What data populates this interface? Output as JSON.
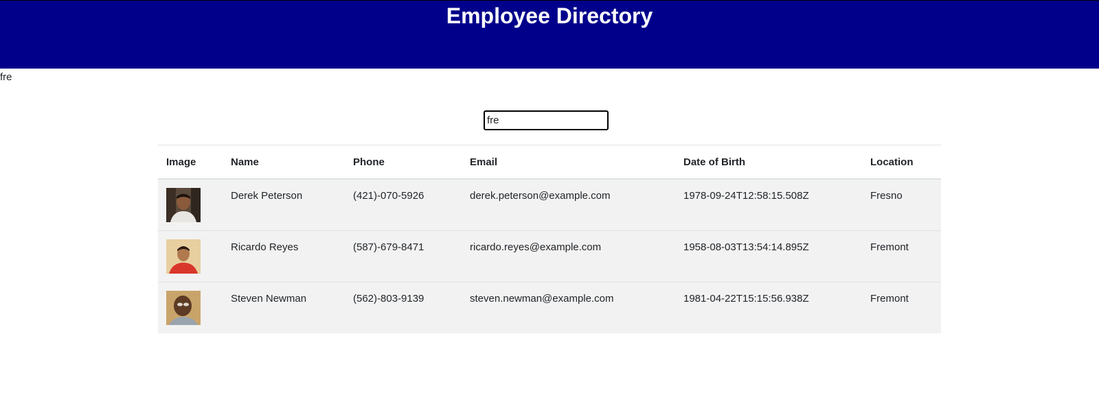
{
  "header": {
    "title": "Employee Directory"
  },
  "search": {
    "echo": "fre",
    "value": "fre"
  },
  "table": {
    "columns": [
      "Image",
      "Name",
      "Phone",
      "Email",
      "Date of Birth",
      "Location"
    ],
    "rows": [
      {
        "image": "portrait-photo",
        "name": "Derek Peterson",
        "phone": "(421)-070-5926",
        "email": "derek.peterson@example.com",
        "dob": "1978-09-24T12:58:15.508Z",
        "location": "Fresno"
      },
      {
        "image": "portrait-photo",
        "name": "Ricardo Reyes",
        "phone": "(587)-679-8471",
        "email": "ricardo.reyes@example.com",
        "dob": "1958-08-03T13:54:14.895Z",
        "location": "Fremont"
      },
      {
        "image": "portrait-photo",
        "name": "Steven Newman",
        "phone": "(562)-803-9139",
        "email": "steven.newman@example.com",
        "dob": "1981-04-22T15:15:56.938Z",
        "location": "Fremont"
      }
    ]
  },
  "colors": {
    "header_bg": "#00008b",
    "row_bg": "#f2f2f2",
    "header_text": "#ffffff"
  }
}
